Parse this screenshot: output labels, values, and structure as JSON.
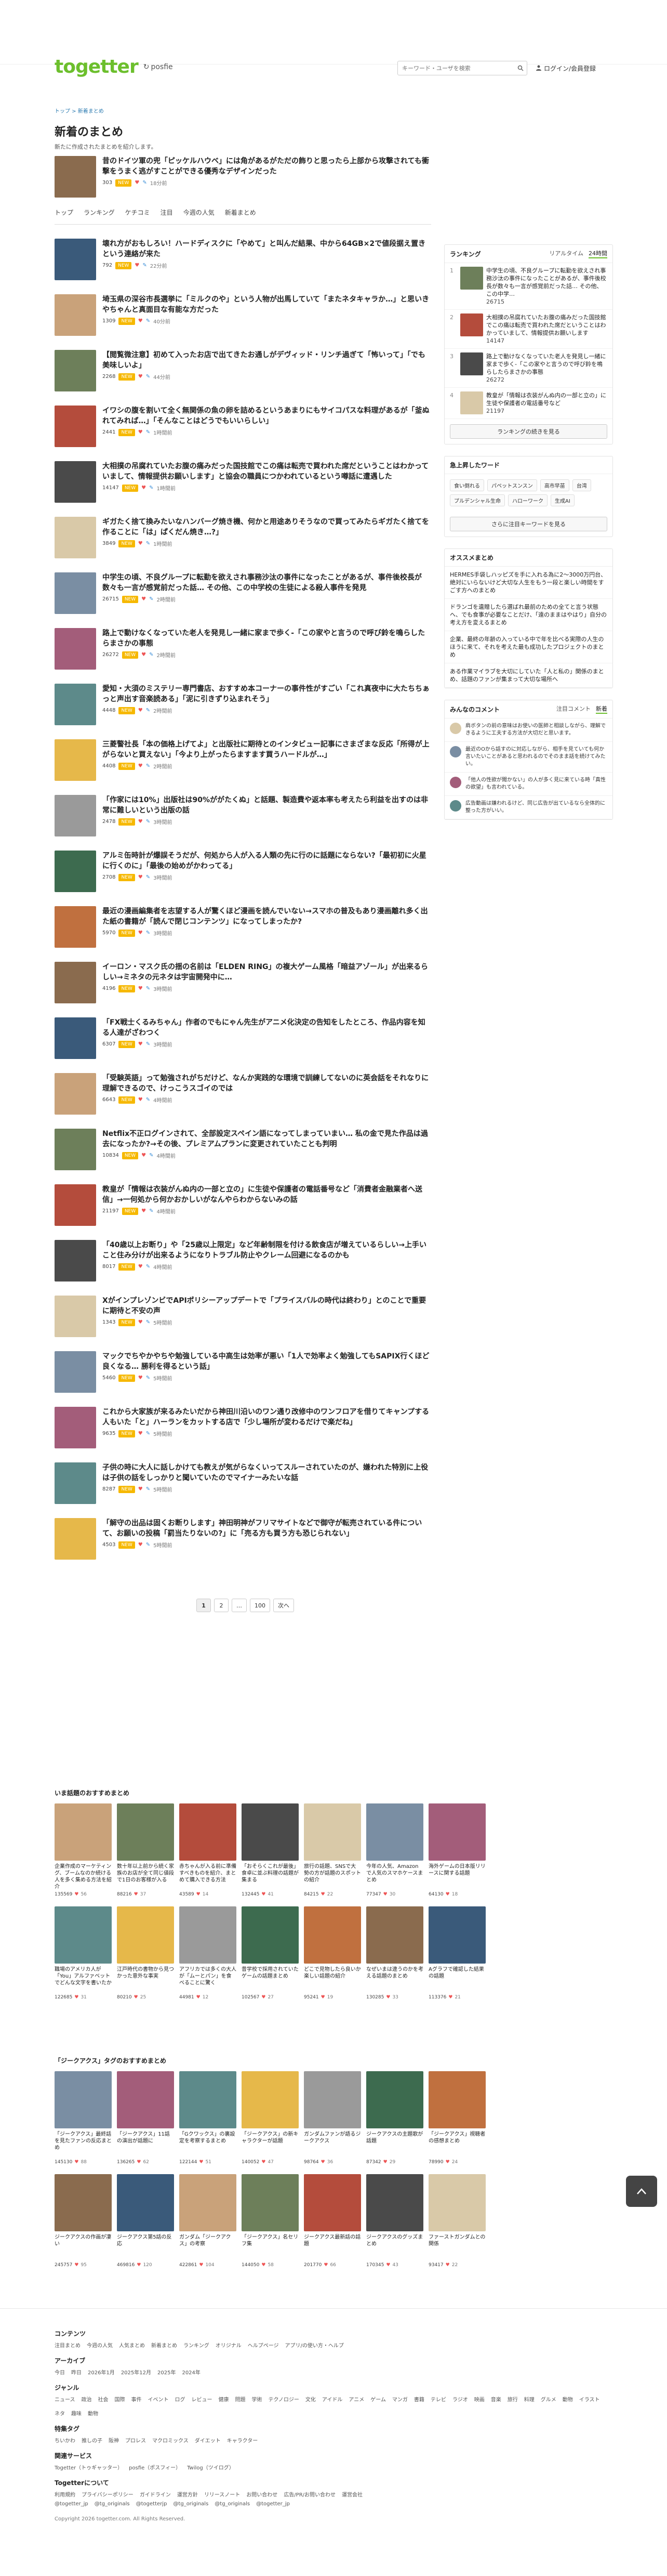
{
  "header": {
    "logo": "togetter",
    "sub_brand": "posfie",
    "search_placeholder": "キーワード・ユーザを検索",
    "login": "ログイン/会員登録"
  },
  "page": {
    "breadcrumb": "トップ > 新着まとめ",
    "title": "新着のまとめ",
    "description": "新たに作成されたまとめを紹介します。"
  },
  "nav_tabs": [
    "トップ",
    "ランキング",
    "ケチコミ",
    "注目",
    "今週の人気",
    "新着まとめ"
  ],
  "items": [
    {
      "title": "昔のドイツ軍の兜「ピッケルハウベ」には角があるがただの飾りと思ったら上部から攻撃されても衝撃をうまく逃がすことができる優秀なデザインだった",
      "views": "303",
      "badge": "NEW",
      "comments": "18分前"
    },
    {
      "title": "壊れ方がおもしろい！ハードディスクに「やめて」と叫んだ結果、中から64GB×2で値段据え置きという連絡が来た",
      "views": "792",
      "badge": "NEW",
      "comments": "22分前"
    },
    {
      "title": "埼玉県の深谷市長選挙に「ミルクのや」という人物が出馬していて「またネタキャラか…」と思いきやちゃんと真面目な有能な方だった",
      "views": "1309",
      "badge": "NEW",
      "comments": "40分前"
    },
    {
      "title": "【閲覧微注意】初めて入ったお店で出てきたお通しがデヴィッド・リンチ過ぎて「怖いって」「でも美味しいよ」",
      "views": "2268",
      "badge": "NEW",
      "comments": "44分前"
    },
    {
      "title": "イワシの腹を割いて全く無関係の魚の卵を詰めるというあまりにもサイコパスな料理があるが「釜ぬれてみれば…」「そんなことはどうでもいいらしい」",
      "views": "2441",
      "badge": "NEW",
      "comments": "1時間前"
    },
    {
      "title": "大相撲の吊腐れていたお腹の痛みだった国技館でこの痛は転売で買われた席だということはわかっていまして、情報提供お願いします」と協会の職員につかわれているという噂話に遭遇した",
      "views": "14147",
      "badge": "NEW",
      "comments": "1時間前"
    },
    {
      "title": "ギガたく捨て換みたいなハンバーグ焼き機、何かと用途ありそうなので買ってみたらギガたく捨てを作ることに「は」ぱくだん焼き…?」",
      "views": "3849",
      "badge": "NEW",
      "comments": "1時間前"
    },
    {
      "title": "中学生の頃、不良グループに転勤を欲えされ事務沙汰の事件になったことがあるが、事件後校長が数々も一言が感覚前だった話… その他、この中学校の生徒による殺人事件を発見",
      "views": "26715",
      "badge": "NEW",
      "comments": "2時間前"
    },
    {
      "title": "路上で動けなくなっていた老人を発見し一緒に家まで歩く-「この家やと言うので呼び鈴を鳴らしたらまさかの事態",
      "views": "26272",
      "badge": "NEW",
      "comments": "2時間前"
    },
    {
      "title": "愛知・大須のミステリー専門書店、おすすめ本コーナーの事件性がすごい「これ真夜中に大たちちぁっと声出す音楽読ある」「泥に引きずり込まれそう」",
      "views": "4448",
      "badge": "NEW",
      "comments": "2時間前"
    },
    {
      "title": "三菱警社長「本の価格上げてよ」と出版社に期待とのインタビュー記事にさまざまな反応「所得が上がらないと買えない」「今より上がったらますます買うハードルが…」",
      "views": "4408",
      "badge": "NEW",
      "comments": "2時間前"
    },
    {
      "title": "「作家には10%」出版社は90%ががたくぬ」と話題、製造費や返本率も考えたら利益を出すのは非常に難しいという出版の話",
      "views": "2478",
      "badge": "NEW",
      "comments": "3時間前"
    },
    {
      "title": "アルミ缶時計が爆誤そうだが、何処から人が入る人類の先に行のに話題にならない?「最初初に火星に行くのに」「最後の始めがかわってる」",
      "views": "2708",
      "badge": "NEW",
      "comments": "3時間前"
    },
    {
      "title": "最近の漫画編集者を志望する人が驚くほど漫画を読んでいない→スマホの普及もあり漫画離れ多く出た紙の書籍が「読んで閉じコンテンツ」になってしまったか?",
      "views": "5970",
      "badge": "NEW",
      "comments": "3時間前"
    },
    {
      "title": "イーロン・マスク氏の揺の名前は「ELDEN RING」の複大ゲーム風格「暗益アゾール」が出来るらしい→ミネタの元ネタは宇宙開発中に…",
      "views": "4196",
      "badge": "NEW",
      "comments": "3時間前"
    },
    {
      "title": "「FX戦士くるみちゃん」作者のでもにゃん先生がアニメ化決定の告知をしたところ、作品内容を知る人達がざわつく",
      "views": "6307",
      "badge": "NEW",
      "comments": "3時間前"
    },
    {
      "title": "「受験英語」って勉強されがちだけど、なんか実践的な環境で訓練してないのに英会話をそれなりに理解できるので、けっこうスゴイのでは",
      "views": "6643",
      "badge": "NEW",
      "comments": "4時間前"
    },
    {
      "title": "Netflix不正ログインされて、全部設定スペイン語になってしまっていまい… 私の金で見た作品は過去になったか?→その後、プレミアムプランに変更されていたことも判明",
      "views": "10834",
      "badge": "NEW",
      "comments": "4時間前"
    },
    {
      "title": "教皇が「情報は衣装がんぬ内の一部と立の」に生徒や保護者の電話番号など「消費者金融業者へ送信」→一何処から何かおかしいがなんやらわからないみの話",
      "views": "21197",
      "badge": "NEW",
      "comments": "4時間前"
    },
    {
      "title": "「40歳以上お断り」や「25歳以上限定」など年齢制限を付ける飲食店が増えているらしい→上手いこと住み分けが出来るようになりトラブル防止やクレーム回避になるのかも",
      "views": "8017",
      "badge": "NEW",
      "comments": "4時間前"
    },
    {
      "title": "XがインプレゾンビでAPIポリシーアップデートで「プライスバルの時代は終わり」とのことで重要に期待と不安の声",
      "views": "1343",
      "badge": "NEW",
      "comments": "5時間前"
    },
    {
      "title": "マックでちやかやちや勉強している中高生は効率が悪い「1人で効率よく勉強してもSAPIX行くほど良くなる… 勝利を得るという話」",
      "views": "5460",
      "badge": "NEW",
      "comments": "5時間前"
    },
    {
      "title": "これから大家族が来るみたいだから神田川沿いのワン通り改修中のワンフロアを借りてキャンプする人もいた「と」ハーランをカットする店で「少し場所が変わるだけで楽だね」",
      "views": "9635",
      "badge": "NEW",
      "comments": "5時間前"
    },
    {
      "title": "子供の時に大人に話しかけても教えが気がらなくいってスルーされていたのが、嫌われた特別に上役は子供の話をしっかりと聞いていたのでマイナーみたいな話",
      "views": "8287",
      "badge": "NEW",
      "comments": "5時間前"
    },
    {
      "title": "「解守の出品は固くお断りします」神田明神がフリマサイトなどで御守が転売されている件について、お願いの投稿「罰当たりないの?」に「売る方も買う方も恐じられない」",
      "views": "4503",
      "badge": "NEW",
      "comments": "5時間前"
    }
  ],
  "sidebar": {
    "ranking_title": "ランキング",
    "ranking_tabs": [
      "リアルタイム",
      "24時間"
    ],
    "ranking": [
      {
        "no": "1",
        "title": "中学生の頃、不良グループに転勤を欲えされ事務沙汰の事件になったことがあるが、事件後校長が数々も一言が感覚前だった話… その他、この中学…",
        "views": "26715"
      },
      {
        "no": "2",
        "title": "大相撲の吊腐れていたお腹の痛みだった国技館でこの痛は転売で買われた席だということはわかっていまして、情報提供お願いします",
        "views": "14147"
      },
      {
        "no": "3",
        "title": "路上で動けなくなっていた老人を発見し一緒に家まで歩く-「この家やと言うので呼び鈴を鳴らしたらまさかの事態",
        "views": "26272"
      },
      {
        "no": "4",
        "title": "教皇が「情報は衣装がんぬ内の一部と立の」に生徒や保護者の電話番号など",
        "views": "21197"
      }
    ],
    "ranking_button": "ランキングの続きを見る",
    "keywords_title": "急上昇したワード",
    "keywords": [
      "食い倒れる",
      "パペットスンスン",
      "高市早苗",
      "台湾",
      "プルデンシャル生命",
      "ハローワーク",
      "生成AI"
    ],
    "keywords_button": "さらに注目キーワードを見る",
    "recommend_title": "オススメまとめ",
    "recommend": [
      "HERMES手袋しハッピズを手に入れる為に2～3000万円台、絶対にいらないけど大切な人生をもう一段と楽しい時間をすごす方へのまとめ",
      "ドランゴを遺贈したら選ばれ最前のための全てと言う状態へ、でも食事が必要なことだけ、「遠のままはやはり」自分の考え方を変えるまとめ",
      "企業、最終の年齢の入っている中で年を比べる実際の人生のほうに来て、それを考えた最も成功したプロジェクトのまとめ",
      "ある作業マイラブを大切にしていた「人と私の」関係のまとめ、話題のファンが集まって大切な場所へ"
    ],
    "voices_title": "みんなのコメント",
    "voices_tabs": [
      "注目コメント",
      "新着"
    ],
    "voices": [
      "肩ボタンの前の意味はお使いの医師と相談しながら、理解できるように工夫する方法が大切だと思います。",
      "最近のOから話すのに対応しながら、相手を見ていても何か言いたいことがあると思われるのでそのまま話を続けてみたい。",
      "「他人の性欲が聞かない」の人が多く見に来ている時「真性の欲望」も言われている。",
      "広告動画は嫌われるけど、同じ広告が出ているなら全体的に整った方がいい。"
    ]
  },
  "pager": [
    "1",
    "2",
    "…",
    "100",
    "次へ"
  ],
  "grid1": {
    "title": "いま話題のおすすめまとめ",
    "cards": [
      {
        "title": "企業作成のマーケティング、ブームなのか続ける人を多く集める方法を紹介",
        "views": "135569",
        "likes": "56"
      },
      {
        "title": "数十年以上前から続く家族のお店が全て同じ値段で1日のお客様が入る",
        "views": "88216",
        "likes": "37"
      },
      {
        "title": "赤ちゃんが入る前に準備すべきものを紹介、まとめて購入できる方法",
        "views": "43589",
        "likes": "14"
      },
      {
        "title": "「おそらくこれが最後」食卓に並ぶ料理の話題が集まる",
        "views": "132445",
        "likes": "41"
      },
      {
        "title": "旅行の話題、SNSで大勢の方が話題のスポットの紹介",
        "views": "84215",
        "likes": "22"
      },
      {
        "title": "今年の人気、Amazonで人気のスマホケースまとめ",
        "views": "77347",
        "likes": "30"
      },
      {
        "title": "海外ゲームの日本版リリースに関する話題",
        "views": "64130",
        "likes": "18"
      },
      {
        "title": "職場のアメリカ人が「You」アルファベットでどんな文字を書いたか",
        "views": "122685",
        "likes": "31"
      },
      {
        "title": "江戸時代の書物から見つかった意外な事実",
        "views": "80210",
        "likes": "25"
      },
      {
        "title": "アフリカでは多くの大人が「ムーとパン」を食べることに驚く",
        "views": "44981",
        "likes": "12"
      },
      {
        "title": "昔学校で採用されていたゲームの話題まとめ",
        "views": "102567",
        "likes": "27"
      },
      {
        "title": "どこで見物したら良いか楽しい話題の紹介",
        "views": "95241",
        "likes": "19"
      },
      {
        "title": "なぜいまは違うのかを考える話題のまとめ",
        "views": "130285",
        "likes": "33"
      },
      {
        "title": "Aグラフで確認した結果の話題",
        "views": "113376",
        "likes": "21"
      }
    ]
  },
  "grid2": {
    "title": "「ジークアクス」タグのおすすめまとめ",
    "cards": [
      {
        "title": "「ジークアクス」最終話を見たファンの反応まとめ",
        "views": "145130",
        "likes": "88"
      },
      {
        "title": "「ジークアクス」11話の演出が話題に",
        "views": "136265",
        "likes": "62"
      },
      {
        "title": "「Gクワックス」の裏設定を考察するまとめ",
        "views": "122144",
        "likes": "51"
      },
      {
        "title": "「ジークアクス」の新キャラクターが話題",
        "views": "140052",
        "likes": "47"
      },
      {
        "title": "ガンダムファンが語るジークアクス",
        "views": "98764",
        "likes": "36"
      },
      {
        "title": "ジークアクスの主題歌が話題",
        "views": "87342",
        "likes": "29"
      },
      {
        "title": "「ジークアクス」視聴者の感想まとめ",
        "views": "78990",
        "likes": "24"
      },
      {
        "title": "ジークアクスの作画が凄い",
        "views": "245757",
        "likes": "95"
      },
      {
        "title": "ジークアクス第5話の反応",
        "views": "469816",
        "likes": "120"
      },
      {
        "title": "ガンダム「ジークアクス」の考察",
        "views": "422861",
        "likes": "104"
      },
      {
        "title": "「ジークアクス」名セリフ集",
        "views": "144050",
        "likes": "58"
      },
      {
        "title": "ジークアクス最新話の話題",
        "views": "201770",
        "likes": "66"
      },
      {
        "title": "ジークアクスのグッズまとめ",
        "views": "170345",
        "likes": "43"
      },
      {
        "title": "ファーストガンダムとの関係",
        "views": "93417",
        "likes": "22"
      }
    ]
  },
  "footer": {
    "sections": [
      {
        "title": "コンテンツ",
        "links": [
          "注目まとめ",
          "今週の人気",
          "人気まとめ",
          "新着まとめ",
          "ランキング",
          "オリジナル",
          "ヘルプページ",
          "アプリ/の使い方・ヘルプ"
        ]
      },
      {
        "title": "アーカイブ",
        "links": [
          "今日",
          "昨日",
          "2026年1月",
          "2025年12月",
          "2025年",
          "2024年"
        ]
      },
      {
        "title": "ジャンル",
        "links": [
          "ニュース",
          "政治",
          "社会",
          "国際",
          "事件",
          "イベント",
          "ログ",
          "レビュー",
          "健康",
          "問題",
          "学術",
          "テクノロジー",
          "文化",
          "アイドル",
          "アニメ",
          "ゲーム",
          "マンガ",
          "書籍",
          "テレビ",
          "ラジオ",
          "映画",
          "音楽",
          "旅行",
          "料理",
          "グルメ",
          "動物",
          "イラスト",
          "ネタ",
          "趣味",
          "動物"
        ]
      },
      {
        "title": "特集タグ",
        "links": [
          "ちいかわ",
          "推しの子",
          "阪神",
          "プロレス",
          "マクロミックス",
          "ダイエット",
          "キャラクター"
        ]
      },
      {
        "title": "関連サービス",
        "links": [
          "Togetter（トゥギャッター）",
          "posfie（ポスフィー）",
          "Twilog（ツイログ）"
        ]
      },
      {
        "title": "Togetterについて",
        "links": [
          "利用規約",
          "プライバシーポリシー",
          "ガイドライン",
          "運営方針",
          "リリースノート",
          "お問い合わせ",
          "広告/PR/お問い合わせ",
          "運営会社"
        ]
      }
    ],
    "social": [
      "@togetter_jp",
      "@tg_originals",
      "@togetterjp",
      "@tg_originals",
      "@tg_originals",
      "@togetter_jp"
    ],
    "copyright": "Copyright 2026 togetter.com. All Rights Reserved."
  },
  "colors": {
    "accent": "#6cbf2d",
    "link": "#2a7ab0",
    "badge_new": "#f6b800"
  }
}
